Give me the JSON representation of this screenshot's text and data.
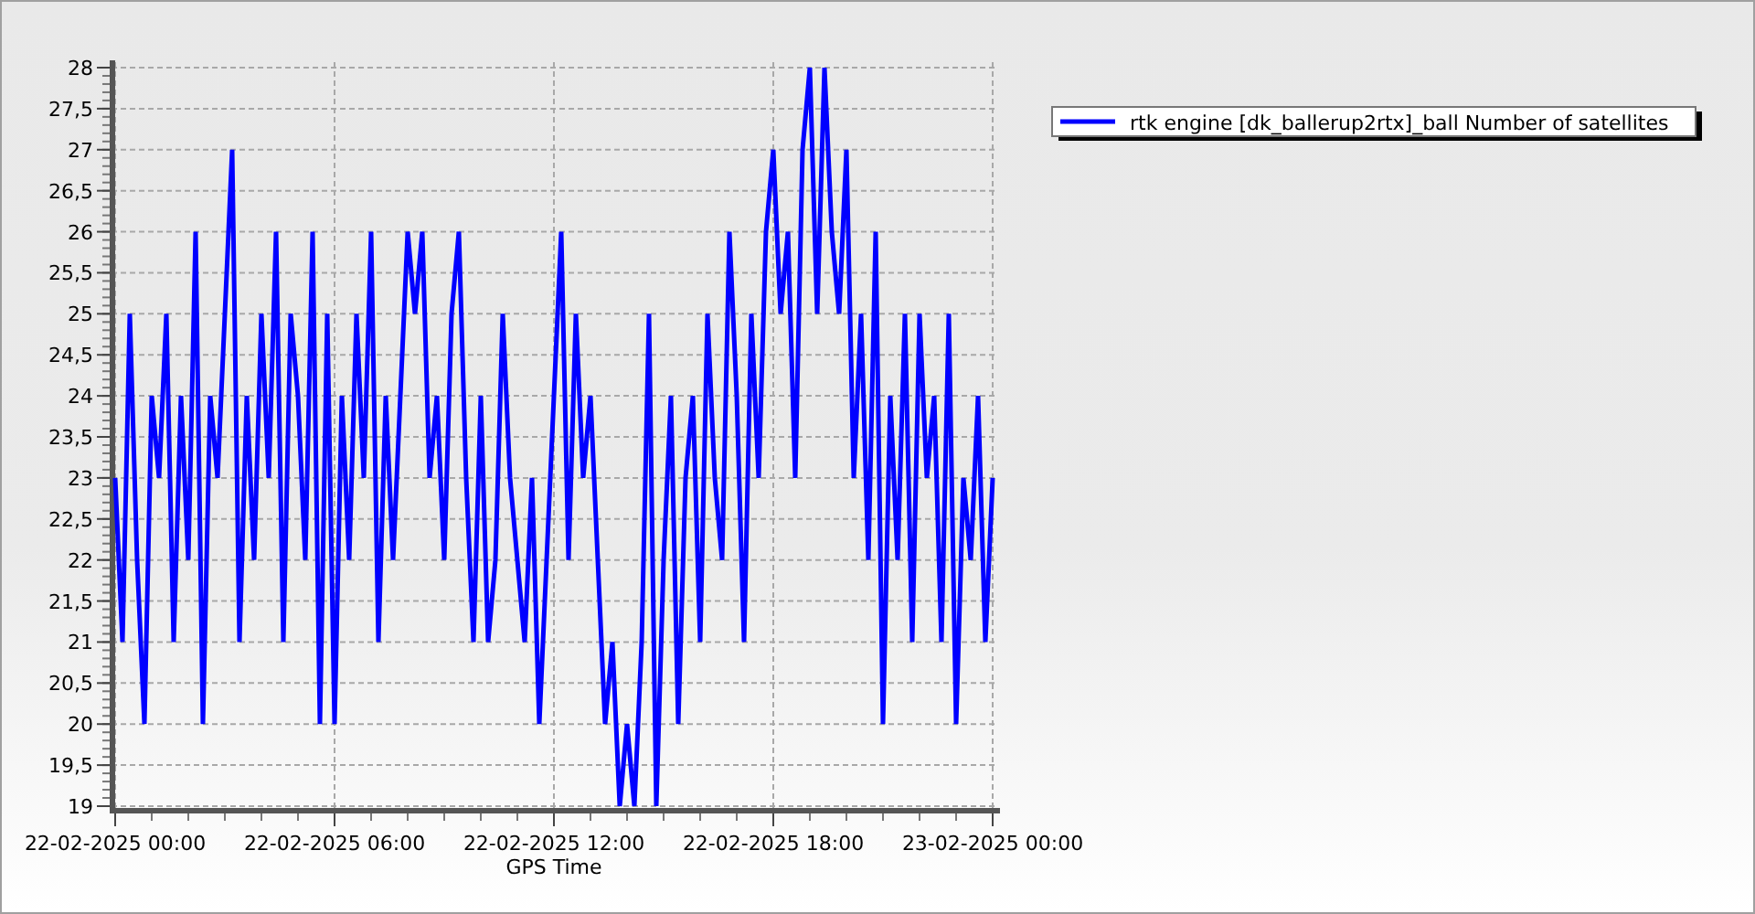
{
  "chart_data": {
    "type": "line",
    "xlabel": "GPS Time",
    "grid": true,
    "ylim": [
      19,
      28
    ],
    "yticks": [
      {
        "value": 19,
        "label": "19"
      },
      {
        "value": 19.5,
        "label": "19,5"
      },
      {
        "value": 20,
        "label": "20"
      },
      {
        "value": 20.5,
        "label": "20,5"
      },
      {
        "value": 21,
        "label": "21"
      },
      {
        "value": 21.5,
        "label": "21,5"
      },
      {
        "value": 22,
        "label": "22"
      },
      {
        "value": 22.5,
        "label": "22,5"
      },
      {
        "value": 23,
        "label": "23"
      },
      {
        "value": 23.5,
        "label": "23,5"
      },
      {
        "value": 24,
        "label": "24"
      },
      {
        "value": 24.5,
        "label": "24,5"
      },
      {
        "value": 25,
        "label": "25"
      },
      {
        "value": 25.5,
        "label": "25,5"
      },
      {
        "value": 26,
        "label": "26"
      },
      {
        "value": 26.5,
        "label": "26,5"
      },
      {
        "value": 27,
        "label": "27"
      },
      {
        "value": 27.5,
        "label": "27,5"
      },
      {
        "value": 28,
        "label": "28"
      }
    ],
    "categories": [
      "22-02-2025 00:00",
      null,
      null,
      null,
      null,
      null,
      null,
      null,
      null,
      null,
      null,
      null,
      null,
      null,
      null,
      null,
      null,
      null,
      null,
      null,
      null,
      null,
      null,
      null,
      null,
      null,
      null,
      null,
      null,
      null,
      "22-02-2025 06:00",
      null,
      null,
      null,
      null,
      null,
      null,
      null,
      null,
      null,
      null,
      null,
      null,
      null,
      null,
      null,
      null,
      null,
      null,
      null,
      null,
      null,
      null,
      null,
      null,
      null,
      null,
      null,
      null,
      null,
      "22-02-2025 12:00",
      null,
      null,
      null,
      null,
      null,
      null,
      null,
      null,
      null,
      null,
      null,
      null,
      null,
      null,
      null,
      null,
      null,
      null,
      null,
      null,
      null,
      null,
      null,
      null,
      null,
      null,
      null,
      null,
      null,
      "22-02-2025 18:00",
      null,
      null,
      null,
      null,
      null,
      null,
      null,
      null,
      null,
      null,
      null,
      null,
      null,
      null,
      null,
      null,
      null,
      null,
      null,
      null,
      null,
      null,
      null,
      null,
      null,
      null,
      null,
      null,
      null,
      "23-02-2025 00:00"
    ],
    "series": [
      {
        "name": "rtk engine [dk_ballerup2rtx]_ball Number of satellites",
        "color": "#0000ff",
        "values": [
          23,
          21,
          25,
          22,
          20,
          24,
          23,
          25,
          21,
          24,
          22,
          26,
          20,
          24,
          23,
          25,
          27,
          21,
          24,
          22,
          25,
          23,
          26,
          21,
          25,
          24,
          22,
          26,
          20,
          25,
          20,
          24,
          22,
          25,
          23,
          26,
          21,
          24,
          22,
          24,
          26,
          25,
          26,
          23,
          24,
          22,
          25,
          26,
          23,
          21,
          24,
          21,
          22,
          25,
          23,
          22,
          21,
          23,
          20,
          22,
          24,
          26,
          22,
          25,
          23,
          24,
          22,
          20,
          21,
          19,
          20,
          19,
          21,
          25,
          19,
          22,
          24,
          20,
          23,
          24,
          21,
          25,
          23,
          22,
          26,
          24,
          21,
          25,
          23,
          26,
          27,
          25,
          26,
          23,
          27,
          28,
          25,
          28,
          26,
          25,
          27,
          23,
          25,
          22,
          26,
          20,
          24,
          22,
          25,
          21,
          25,
          23,
          24,
          21,
          25,
          20,
          23,
          22,
          24,
          21,
          23
        ]
      }
    ]
  }
}
